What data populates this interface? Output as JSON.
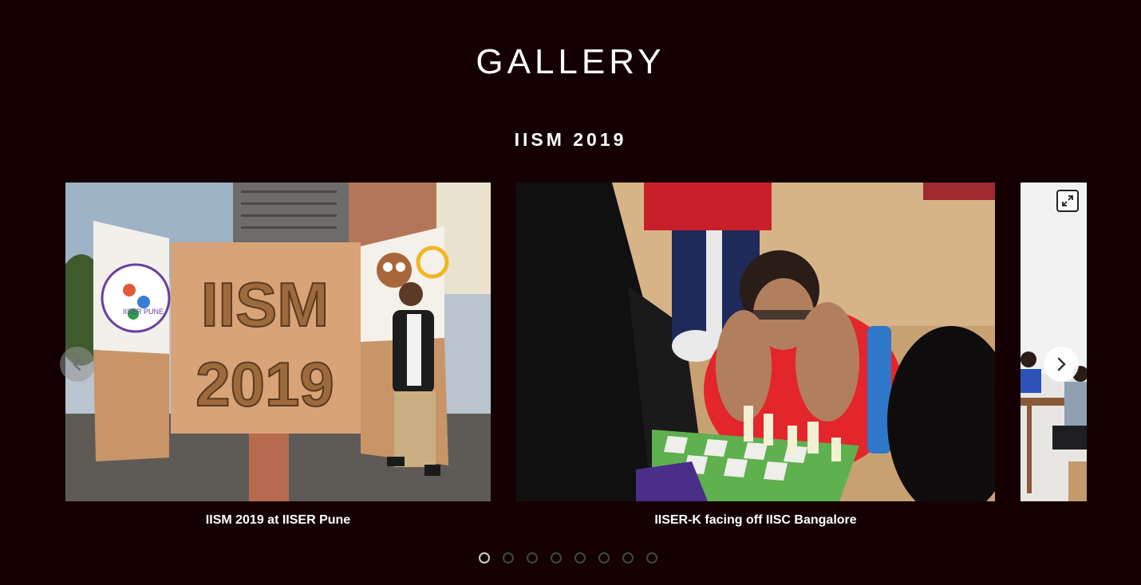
{
  "page": {
    "title": "GALLERY",
    "section_title": "IISM 2019"
  },
  "slides": [
    {
      "caption": "IISM 2019 at IISER Pune",
      "board_line1": "IISM",
      "board_line2": "2019",
      "banner_text": "IISER PUNE"
    },
    {
      "caption": "IISER-K facing off IISC Bangalore"
    },
    {
      "caption": ""
    }
  ],
  "controls": {
    "prev_icon": "chevron-left-icon",
    "next_icon": "chevron-right-icon",
    "expand_icon": "expand-icon"
  },
  "pagination": {
    "count": 8,
    "active_index": 0
  },
  "colors": {
    "background": "#140003",
    "text": "#ffffff",
    "dot_active": "#cfcfcf",
    "dot_inactive": "#444444"
  }
}
